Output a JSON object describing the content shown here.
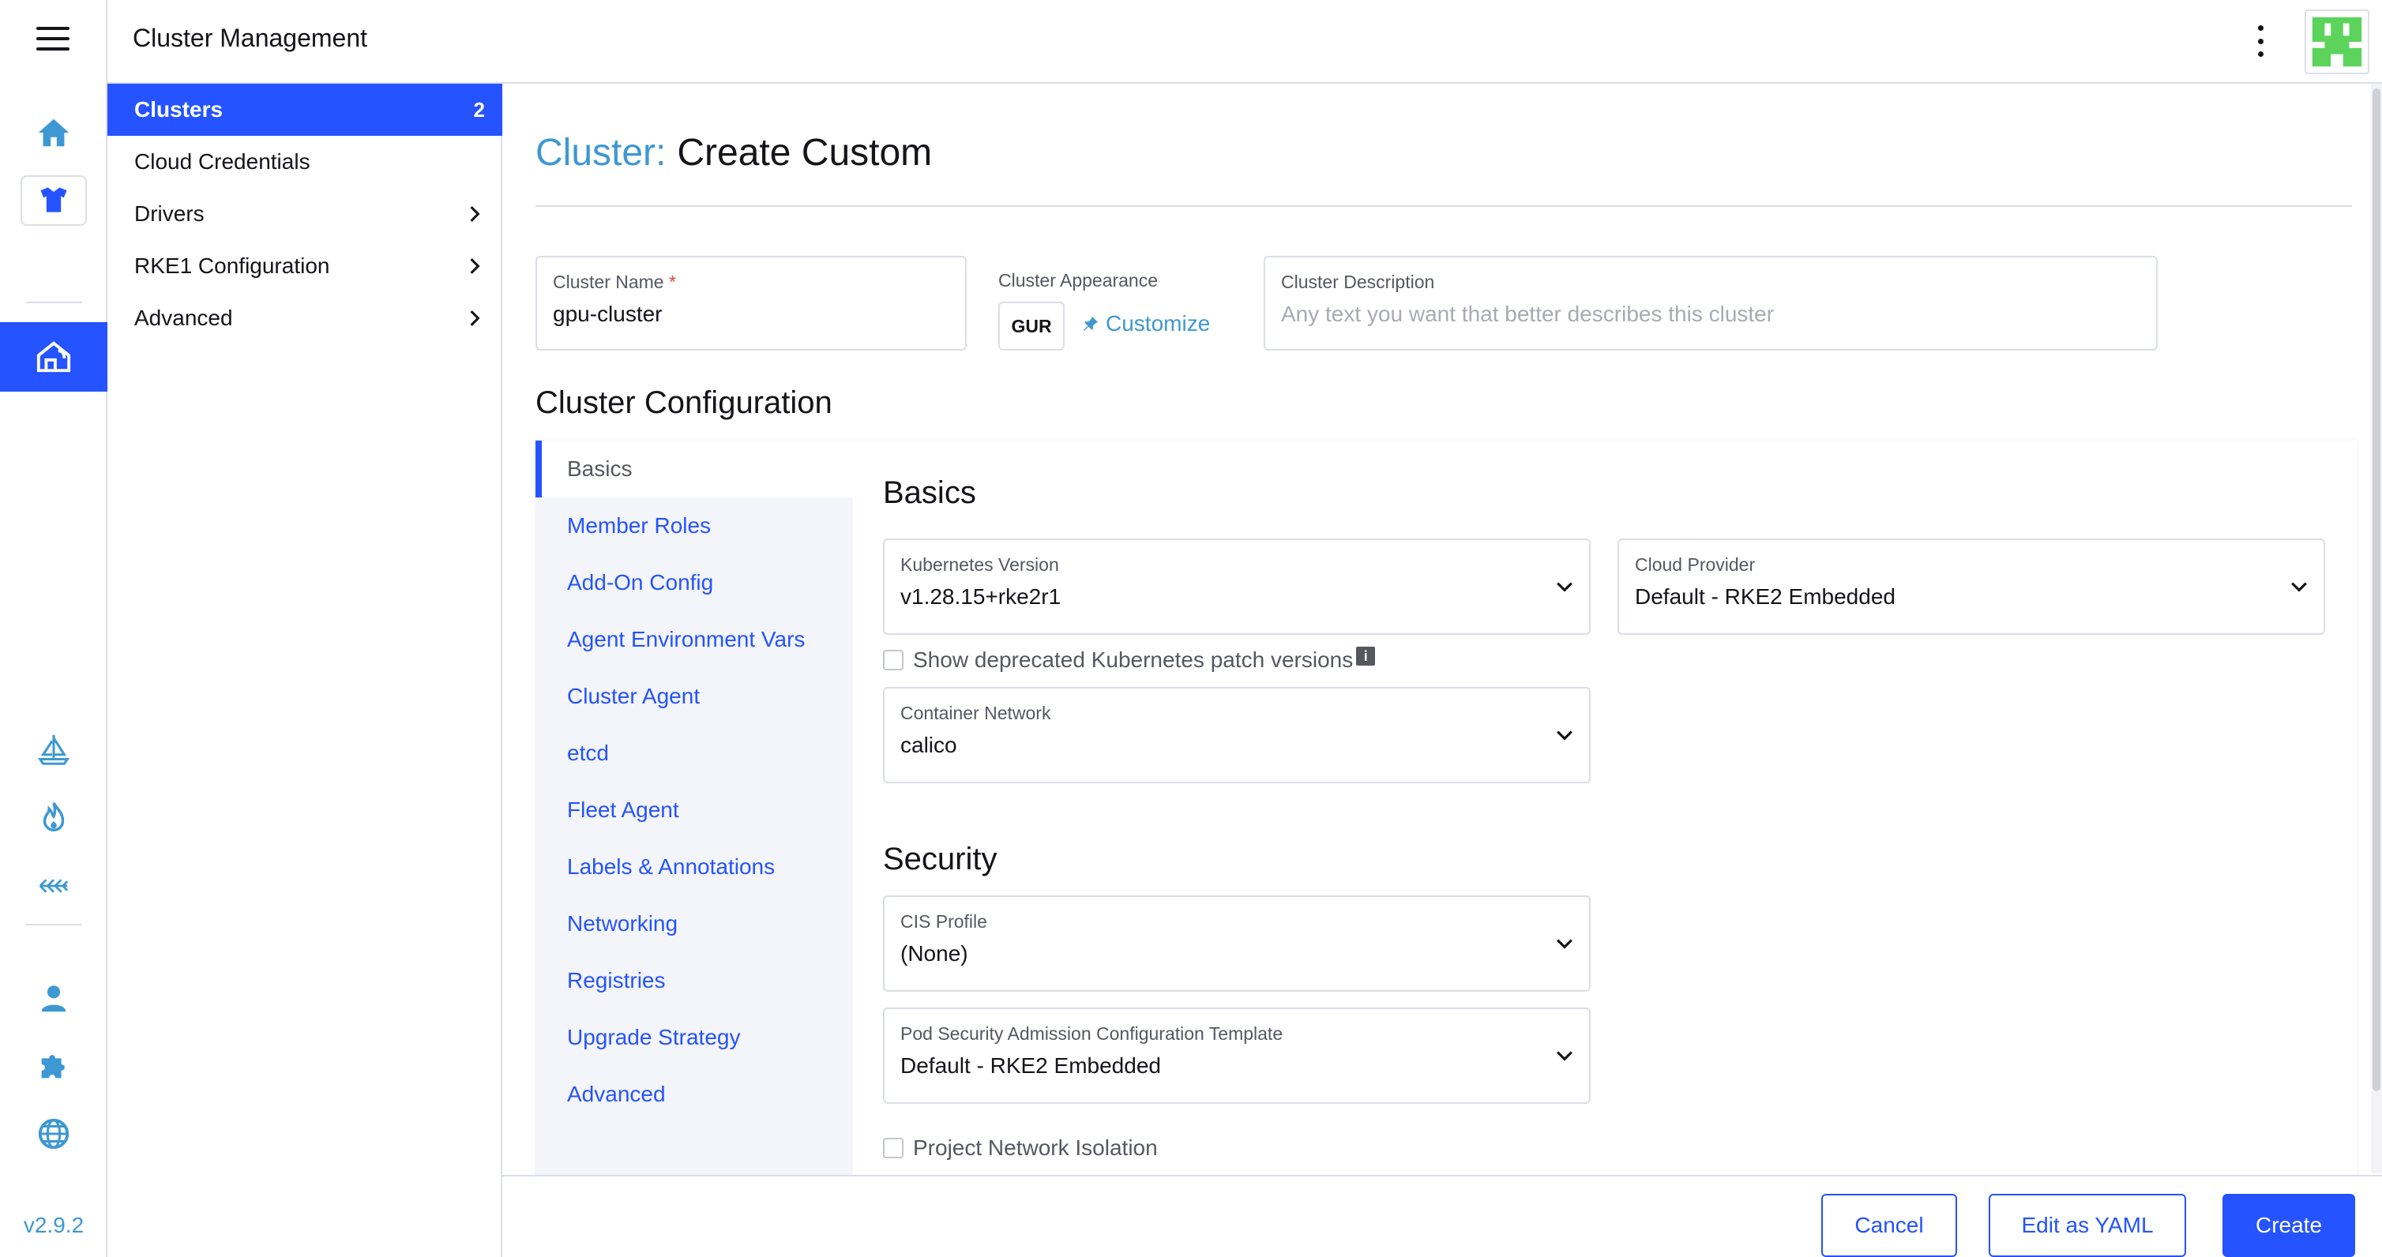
{
  "header": {
    "title": "Cluster Management"
  },
  "rail": {
    "version": "v2.9.2"
  },
  "sidenav": {
    "items": [
      {
        "label": "Clusters",
        "count": "2"
      },
      {
        "label": "Cloud Credentials"
      },
      {
        "label": "Drivers"
      },
      {
        "label": "RKE1 Configuration"
      },
      {
        "label": "Advanced"
      }
    ]
  },
  "page": {
    "crumb": "Cluster:",
    "title": "Create Custom"
  },
  "form": {
    "cluster_name": {
      "label": "Cluster Name",
      "required": "*",
      "value": "gpu-cluster"
    },
    "appearance": {
      "label": "Cluster Appearance",
      "badge": "GUR",
      "customize": "Customize"
    },
    "description": {
      "label": "Cluster Description",
      "placeholder": "Any text you want that better describes this cluster"
    }
  },
  "config": {
    "title": "Cluster Configuration",
    "tabs": [
      "Basics",
      "Member Roles",
      "Add-On Config",
      "Agent Environment Vars",
      "Cluster Agent",
      "etcd",
      "Fleet Agent",
      "Labels & Annotations",
      "Networking",
      "Registries",
      "Upgrade Strategy",
      "Advanced"
    ],
    "basics": {
      "title": "Basics",
      "k8s_version": {
        "label": "Kubernetes Version",
        "value": "v1.28.15+rke2r1"
      },
      "cloud_provider": {
        "label": "Cloud Provider",
        "value": "Default - RKE2 Embedded"
      },
      "show_deprecated": "Show deprecated Kubernetes patch versions",
      "info_glyph": "i",
      "container_network": {
        "label": "Container Network",
        "value": "calico"
      }
    },
    "security": {
      "title": "Security",
      "cis_profile": {
        "label": "CIS Profile",
        "value": "(None)"
      },
      "psa_template": {
        "label": "Pod Security Admission Configuration Template",
        "value": "Default - RKE2 Embedded"
      },
      "project_isolation": "Project Network Isolation"
    }
  },
  "footer": {
    "cancel": "Cancel",
    "edit_yaml": "Edit as YAML",
    "create": "Create"
  },
  "colors": {
    "primary": "#2453ff",
    "link": "#3d98d3",
    "border": "#dcdee7",
    "avatar": "#5cd45c"
  }
}
